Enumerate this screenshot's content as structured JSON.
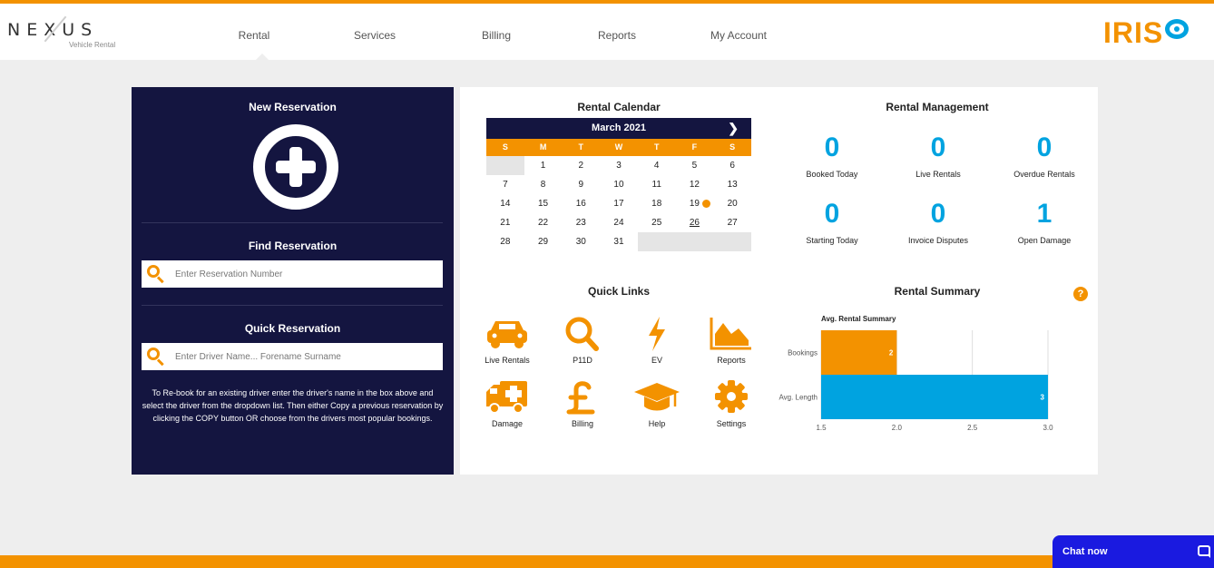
{
  "header": {
    "logo": "NEXUS",
    "logo_sub": "Vehicle Rental",
    "nav": [
      "Rental",
      "Services",
      "Billing",
      "Reports",
      "My Account"
    ],
    "brand": "IRIS"
  },
  "left": {
    "new_reservation": "New Reservation",
    "find_reservation": "Find Reservation",
    "find_placeholder": "Enter Reservation Number",
    "quick_reservation": "Quick Reservation",
    "quick_placeholder": "Enter Driver Name... Forename Surname",
    "help_text": "To Re-book for an existing driver enter the driver's name in the box above and select the driver from the dropdown list. Then either Copy a previous reservation by clicking the COPY button OR choose from the drivers most popular bookings."
  },
  "calendar": {
    "title": "Rental Calendar",
    "month": "March 2021",
    "next_icon": "chevron-right-icon",
    "weekdays": [
      "S",
      "M",
      "T",
      "W",
      "T",
      "F",
      "S"
    ],
    "cells": [
      "",
      "1",
      "2",
      "3",
      "4",
      "5",
      "6",
      "7",
      "8",
      "9",
      "10",
      "11",
      "12",
      "13",
      "14",
      "15",
      "16",
      "17",
      "18",
      "19",
      "20",
      "21",
      "22",
      "23",
      "24",
      "25",
      "26",
      "27",
      "28",
      "29",
      "30",
      "31",
      "",
      "",
      ""
    ],
    "today": "26",
    "marked": "19",
    "accent": "#f39200",
    "header_color": "#141540"
  },
  "management": {
    "title": "Rental Management",
    "stats": [
      {
        "value": "0",
        "label": "Booked Today"
      },
      {
        "value": "0",
        "label": "Live Rentals"
      },
      {
        "value": "0",
        "label": "Overdue Rentals"
      },
      {
        "value": "0",
        "label": "Starting Today"
      },
      {
        "value": "0",
        "label": "Invoice Disputes"
      },
      {
        "value": "1",
        "label": "Open Damage"
      }
    ],
    "value_color": "#00a3e0"
  },
  "quick_links": {
    "title": "Quick Links",
    "items": [
      {
        "label": "Live Rentals",
        "icon": "car-icon"
      },
      {
        "label": "P11D",
        "icon": "search-icon"
      },
      {
        "label": "EV",
        "icon": "lightning-icon"
      },
      {
        "label": "Reports",
        "icon": "area-chart-icon"
      },
      {
        "label": "Damage",
        "icon": "ambulance-icon"
      },
      {
        "label": "Billing",
        "icon": "pound-icon"
      },
      {
        "label": "Help",
        "icon": "graduation-cap-icon"
      },
      {
        "label": "Settings",
        "icon": "gear-icon"
      }
    ]
  },
  "summary": {
    "title": "Rental Summary",
    "help": "?"
  },
  "chart_data": {
    "type": "bar",
    "orientation": "horizontal",
    "title": "Avg. Rental Summary",
    "categories": [
      "Bookings",
      "Avg. Length"
    ],
    "values": [
      2,
      3
    ],
    "colors": [
      "#f39200",
      "#00a3e0"
    ],
    "xlim": [
      1.5,
      3.0
    ],
    "xticks": [
      "1.5",
      "2.0",
      "2.5",
      "3.0"
    ],
    "grid": true
  },
  "chat": {
    "label": "Chat now"
  }
}
